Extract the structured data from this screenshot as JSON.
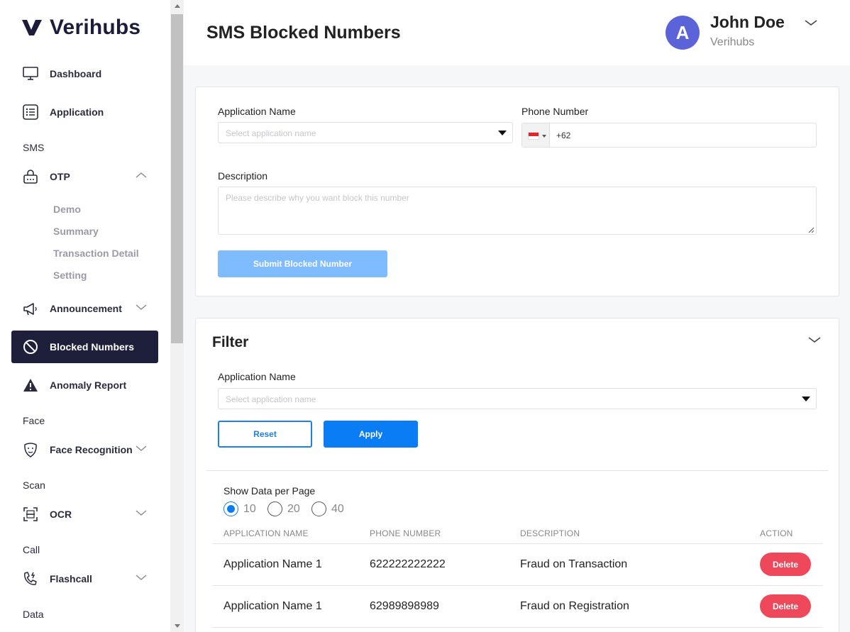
{
  "brand": {
    "name": "Verihubs",
    "logo_mark": "V"
  },
  "sidebar": {
    "items": [
      {
        "label": "Dashboard",
        "icon": "monitor-icon"
      },
      {
        "label": "Application",
        "icon": "list-icon"
      }
    ],
    "sms_section": "SMS",
    "otp": {
      "label": "OTP",
      "icon": "lock-icon",
      "expanded": true,
      "children": [
        "Demo",
        "Summary",
        "Transaction Detail",
        "Setting"
      ]
    },
    "announcement": {
      "label": "Announcement",
      "icon": "megaphone-icon"
    },
    "blocked": {
      "label": "Blocked Numbers",
      "icon": "block-icon",
      "active": true
    },
    "anomaly": {
      "label": "Anomaly Report",
      "icon": "warning-icon"
    },
    "face_section": "Face",
    "face_recognition": {
      "label": "Face Recognition",
      "icon": "face-icon"
    },
    "scan_section": "Scan",
    "ocr": {
      "label": "OCR",
      "icon": "scan-icon"
    },
    "call_section": "Call",
    "flashcall": {
      "label": "Flashcall",
      "icon": "phone-icon"
    },
    "data_section": "Data"
  },
  "header": {
    "title": "SMS Blocked Numbers",
    "user": {
      "initial": "A",
      "name": "John Doe",
      "org": "Verihubs"
    }
  },
  "form": {
    "app_label": "Application Name",
    "app_placeholder": "Select application name",
    "phone_label": "Phone Number",
    "phone_value": "+62",
    "desc_label": "Description",
    "desc_placeholder": "Please describe why you want block this number",
    "submit_label": "Submit Blocked Number"
  },
  "filter": {
    "title": "Filter",
    "app_label": "Application Name",
    "app_placeholder": "Select application name",
    "reset_label": "Reset",
    "apply_label": "Apply"
  },
  "pagination": {
    "label": "Show Data per Page",
    "options": [
      "10",
      "20",
      "40"
    ],
    "selected": "10"
  },
  "table": {
    "headers": [
      "APPLICATION NAME",
      "PHONE NUMBER",
      "DESCRIPTION",
      "ACTION"
    ],
    "rows": [
      {
        "app": "Application Name 1",
        "phone": "622222222222",
        "desc": "Fraud on Transaction",
        "action": "Delete"
      },
      {
        "app": "Application Name 1",
        "phone": "62989898989",
        "desc": "Fraud on Registration",
        "action": "Delete"
      }
    ]
  },
  "colors": {
    "sidebar_active": "#1e1f3b",
    "primary": "#0a7df5",
    "submit_disabled": "#7fbcff",
    "delete": "#f0485b",
    "avatar": "#5b63d9"
  }
}
